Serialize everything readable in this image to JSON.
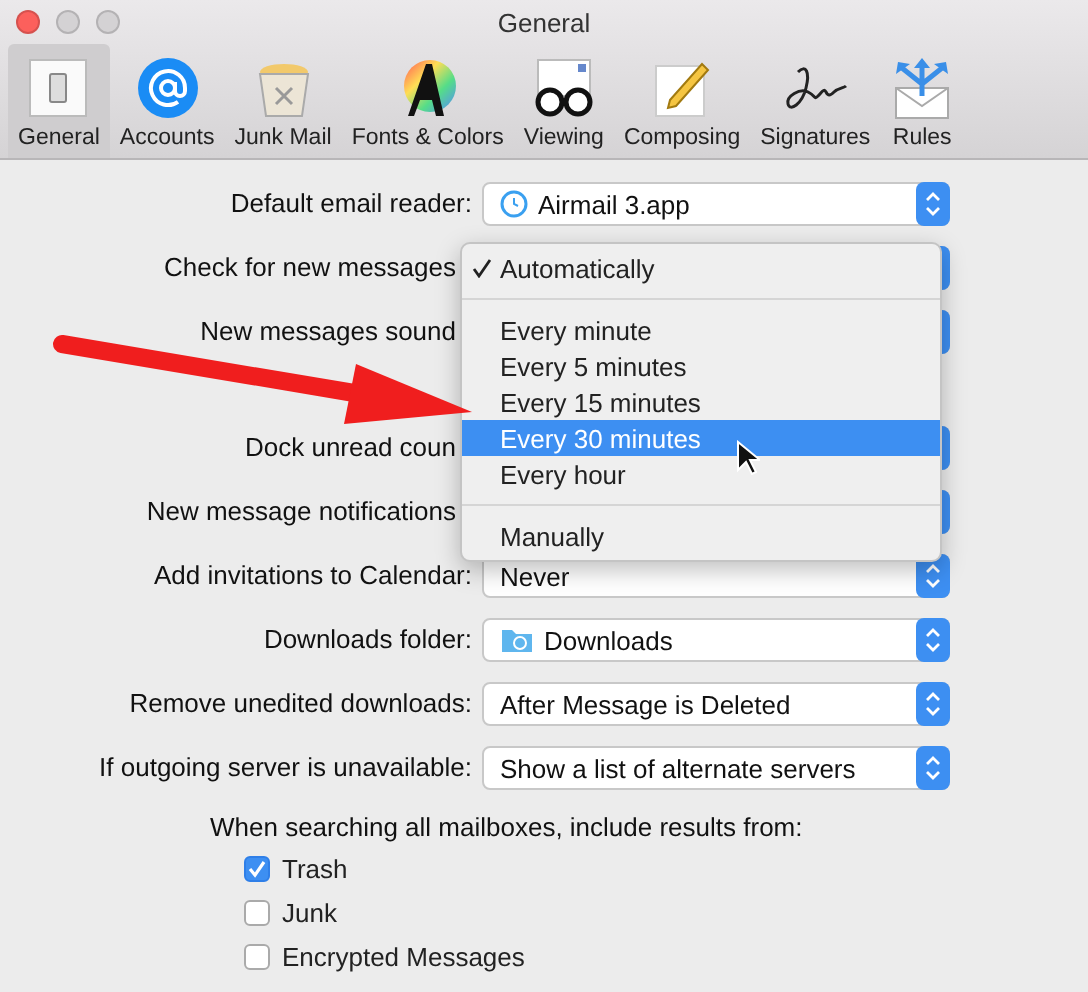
{
  "window": {
    "title": "General"
  },
  "toolbar": {
    "items": [
      {
        "label": "General",
        "selected": true
      },
      {
        "label": "Accounts",
        "selected": false
      },
      {
        "label": "Junk Mail",
        "selected": false
      },
      {
        "label": "Fonts & Colors",
        "selected": false
      },
      {
        "label": "Viewing",
        "selected": false
      },
      {
        "label": "Composing",
        "selected": false
      },
      {
        "label": "Signatures",
        "selected": false
      },
      {
        "label": "Rules",
        "selected": false
      }
    ]
  },
  "settings": [
    {
      "label": "Default email reader:",
      "value": "Airmail 3.app",
      "kind": "app"
    },
    {
      "label": "Check for new messages",
      "kind": "popup"
    },
    {
      "label": "New messages sound",
      "kind": "popup"
    },
    {
      "kind": "spacer"
    },
    {
      "label": "Dock unread coun",
      "kind": "popup"
    },
    {
      "label": "New message notifications",
      "kind": "popup"
    },
    {
      "label": "Add invitations to Calendar:",
      "value": "Never",
      "kind": "popup"
    },
    {
      "label": "Downloads folder:",
      "value": "Downloads",
      "kind": "folder"
    },
    {
      "label": "Remove unedited downloads:",
      "value": "After Message is Deleted",
      "kind": "popup"
    },
    {
      "label": "If outgoing server is unavailable:",
      "value": "Show a list of alternate servers",
      "kind": "popup"
    }
  ],
  "menu": {
    "items": [
      {
        "kind": "item",
        "label": "Automatically",
        "checked": true,
        "selected": false
      },
      {
        "kind": "separator"
      },
      {
        "kind": "item",
        "label": "Every minute",
        "checked": false,
        "selected": false
      },
      {
        "kind": "item",
        "label": "Every 5 minutes",
        "checked": false,
        "selected": false
      },
      {
        "kind": "item",
        "label": "Every 15 minutes",
        "checked": false,
        "selected": false
      },
      {
        "kind": "item",
        "label": "Every 30 minutes",
        "checked": false,
        "selected": true
      },
      {
        "kind": "item",
        "label": "Every hour",
        "checked": false,
        "selected": false
      },
      {
        "kind": "separator"
      },
      {
        "kind": "item",
        "label": "Manually",
        "checked": false,
        "selected": false
      }
    ]
  },
  "search": {
    "heading": "When searching all mailboxes, include results from:",
    "options": [
      {
        "label": "Trash",
        "checked": true
      },
      {
        "label": "Junk",
        "checked": false
      },
      {
        "label": "Encrypted Messages",
        "checked": false
      }
    ]
  }
}
